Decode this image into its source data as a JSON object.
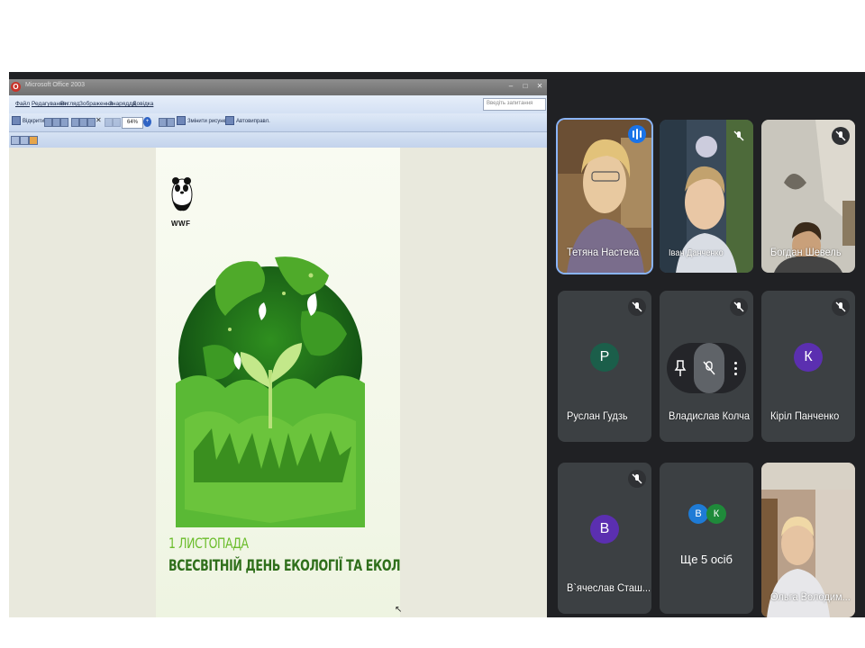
{
  "window": {
    "title": "Microsoft Office 2003",
    "menu": [
      "Файл",
      "Редагування",
      "Вигляд",
      "Зображення",
      "Знаряддя",
      "Довідка"
    ],
    "help_search_placeholder": "Введіть запитання",
    "toolbar": {
      "open_label": "Відкрити...",
      "zoom_value": "64%",
      "edit_picture_label": "Змінити рисунки...",
      "autofix_label": "Автовиправл."
    }
  },
  "poster": {
    "logo_text": "WWF",
    "date_line": "1 ЛИСТОПАДА",
    "caption_line": "ВСЕСВІТНІЙ ДЕНЬ ЕКОЛОГІЇ ТА ЕКОЛОГІВ"
  },
  "participants": [
    {
      "name": "Тетяна Настека",
      "kind": "video",
      "speaking": true
    },
    {
      "name": "Іван Данченко",
      "kind": "video",
      "muted": true
    },
    {
      "name": "Богдан Шевель",
      "kind": "video",
      "muted": true
    },
    {
      "name": "Руслан Гудзь",
      "kind": "avatar",
      "initial": "Р",
      "avatar_color": "#1b5e4a",
      "muted": true
    },
    {
      "name": "Владислав Колча",
      "kind": "avatar",
      "hover_controls": true
    },
    {
      "name": "Кіріл Панченко",
      "kind": "avatar",
      "initial": "К",
      "avatar_color": "#5b2fb0",
      "muted": true
    },
    {
      "name": "В`ячеслав Сташ...",
      "kind": "avatar",
      "initial": "В",
      "avatar_color": "#5b2fb0",
      "muted": true
    },
    {
      "name": "Ще 5 осіб",
      "kind": "group",
      "initials": [
        "В",
        "К"
      ],
      "avatar_colors": [
        "#1e7bd6",
        "#1f8a3a"
      ]
    },
    {
      "name": "Ольга Володим...",
      "kind": "video"
    }
  ]
}
